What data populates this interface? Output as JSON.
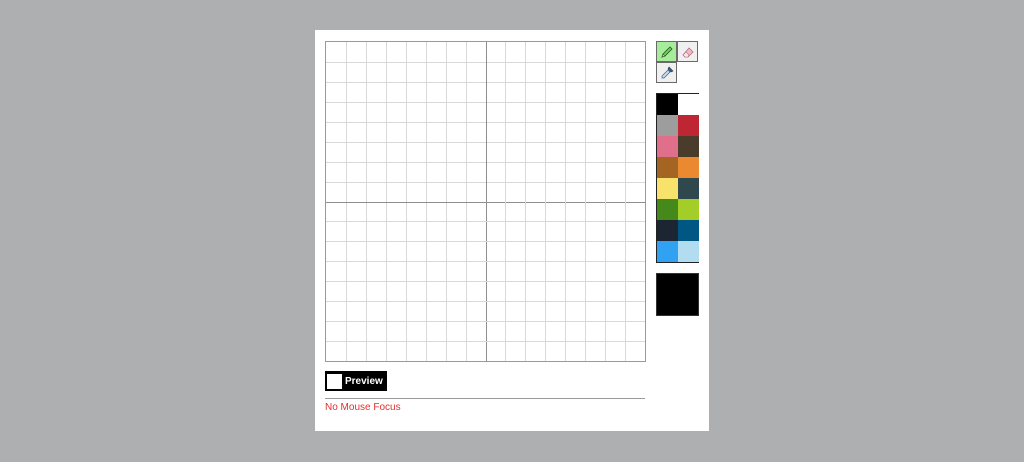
{
  "grid": {
    "cells_per_side": 16,
    "line_color": "#d9d9d9",
    "center_line_color": "#8e8e8e"
  },
  "tools": [
    {
      "name": "pencil-icon",
      "active": true
    },
    {
      "name": "eraser-icon",
      "active": false
    },
    {
      "name": "eyedropper-icon",
      "active": false
    }
  ],
  "palette": [
    "#000000",
    "#ffffff",
    "#9d9d9d",
    "#be2633",
    "#e06f8b",
    "#493c2b",
    "#a46422",
    "#eb8931",
    "#f7e26b",
    "#2f484e",
    "#44891a",
    "#a3ce27",
    "#1b2632",
    "#005784",
    "#31a2f2",
    "#b2dcef"
  ],
  "current_color": "#000000",
  "preview": {
    "label": "Preview"
  },
  "status": {
    "text": "No Mouse Focus"
  }
}
